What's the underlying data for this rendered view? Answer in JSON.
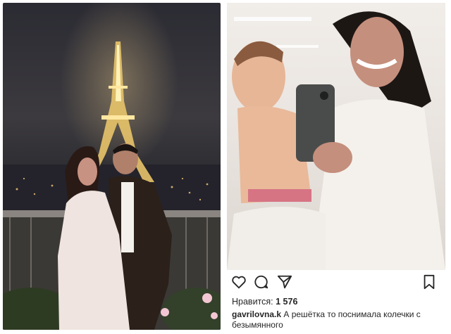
{
  "post": {
    "likes_label": "Нравится:",
    "likes_count": "1 576",
    "username": "gavrilovna.k",
    "caption_text": "А решётка то поснимала колечки с безымянного"
  },
  "icons": [
    "heart-icon",
    "comment-icon",
    "share-icon",
    "bookmark-icon"
  ],
  "colors": {
    "text": "#262626",
    "background": "#ffffff"
  }
}
